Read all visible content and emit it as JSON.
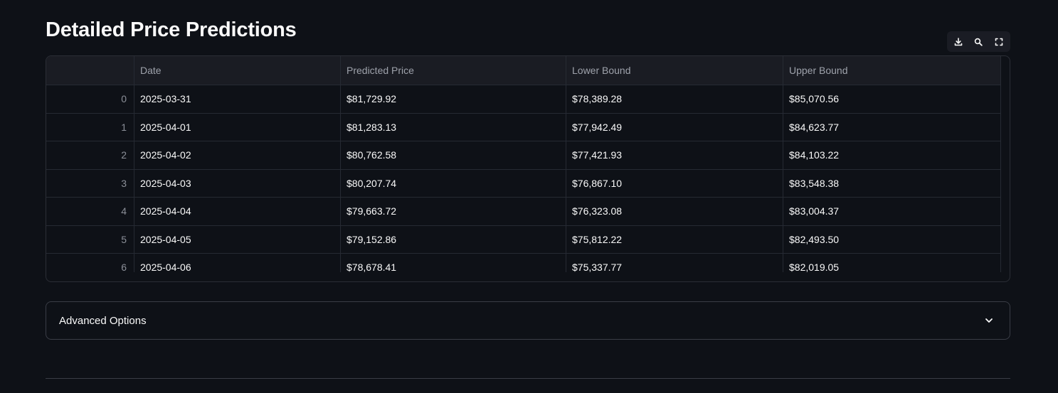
{
  "title": "Detailed Price Predictions",
  "toolbar": {
    "icons": [
      "download-icon",
      "search-icon",
      "fullscreen-icon"
    ]
  },
  "table": {
    "columns": [
      "",
      "Date",
      "Predicted Price",
      "Lower Bound",
      "Upper Bound"
    ],
    "rows": [
      [
        "0",
        "2025-03-31",
        "$81,729.92",
        "$78,389.28",
        "$85,070.56"
      ],
      [
        "1",
        "2025-04-01",
        "$81,283.13",
        "$77,942.49",
        "$84,623.77"
      ],
      [
        "2",
        "2025-04-02",
        "$80,762.58",
        "$77,421.93",
        "$84,103.22"
      ],
      [
        "3",
        "2025-04-03",
        "$80,207.74",
        "$76,867.10",
        "$83,548.38"
      ],
      [
        "4",
        "2025-04-04",
        "$79,663.72",
        "$76,323.08",
        "$83,004.37"
      ],
      [
        "5",
        "2025-04-05",
        "$79,152.86",
        "$75,812.22",
        "$82,493.50"
      ],
      [
        "6",
        "2025-04-06",
        "$78,678.41",
        "$75,337.77",
        "$82,019.05"
      ]
    ]
  },
  "expander": {
    "label": "Advanced Options",
    "icon": "chevron-down-icon"
  },
  "colors": {
    "background": "#0e1117",
    "header_background": "#1a1c23",
    "text": "#fafafa",
    "muted_text": "#8b8f98",
    "border": "#262a33"
  }
}
